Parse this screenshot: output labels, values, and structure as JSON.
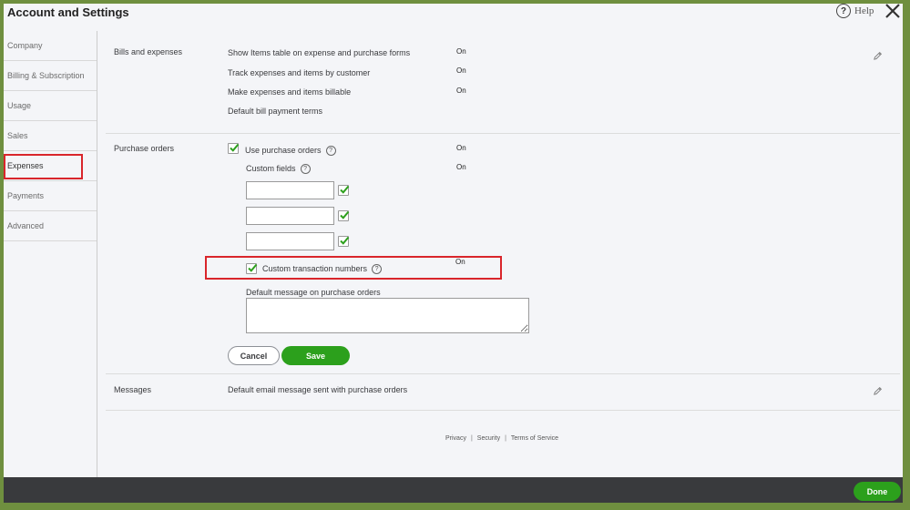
{
  "window": {
    "title": "Account and Settings",
    "help_label": "Help"
  },
  "sidebar": {
    "items": [
      {
        "label": "Company"
      },
      {
        "label": "Billing & Subscription"
      },
      {
        "label": "Usage"
      },
      {
        "label": "Sales"
      },
      {
        "label": "Expenses",
        "selected": true
      },
      {
        "label": "Payments"
      },
      {
        "label": "Advanced"
      }
    ]
  },
  "bills": {
    "section_label": "Bills and expenses",
    "rows": [
      {
        "label": "Show Items table on expense and purchase forms",
        "value": "On"
      },
      {
        "label": "Track expenses and items by customer",
        "value": "On"
      },
      {
        "label": "Make expenses and items billable",
        "value": "On"
      },
      {
        "label": "Default bill payment terms",
        "value": ""
      }
    ]
  },
  "purchase_orders": {
    "section_label": "Purchase orders",
    "use_po_label": "Use purchase orders",
    "use_po_value": "On",
    "use_po_checked": true,
    "custom_fields_label": "Custom fields",
    "custom_fields_value": "On",
    "custom_fields": [
      {
        "value": "",
        "checked": true
      },
      {
        "value": "",
        "checked": true
      },
      {
        "value": "",
        "checked": true
      }
    ],
    "custom_txn_label": "Custom transaction numbers",
    "custom_txn_value": "On",
    "custom_txn_checked": true,
    "default_message_label": "Default message on purchase orders",
    "default_message_value": "",
    "cancel_label": "Cancel",
    "save_label": "Save"
  },
  "messages": {
    "section_label": "Messages",
    "row_label": "Default email message sent with purchase orders"
  },
  "footer": {
    "privacy": "Privacy",
    "security": "Security",
    "terms": "Terms of Service",
    "separator": "|"
  },
  "bottom_bar": {
    "done_label": "Done"
  },
  "colors": {
    "accent_green": "#2ca01c",
    "highlight_red": "#d9252b",
    "bottom_bar": "#393a3d"
  }
}
